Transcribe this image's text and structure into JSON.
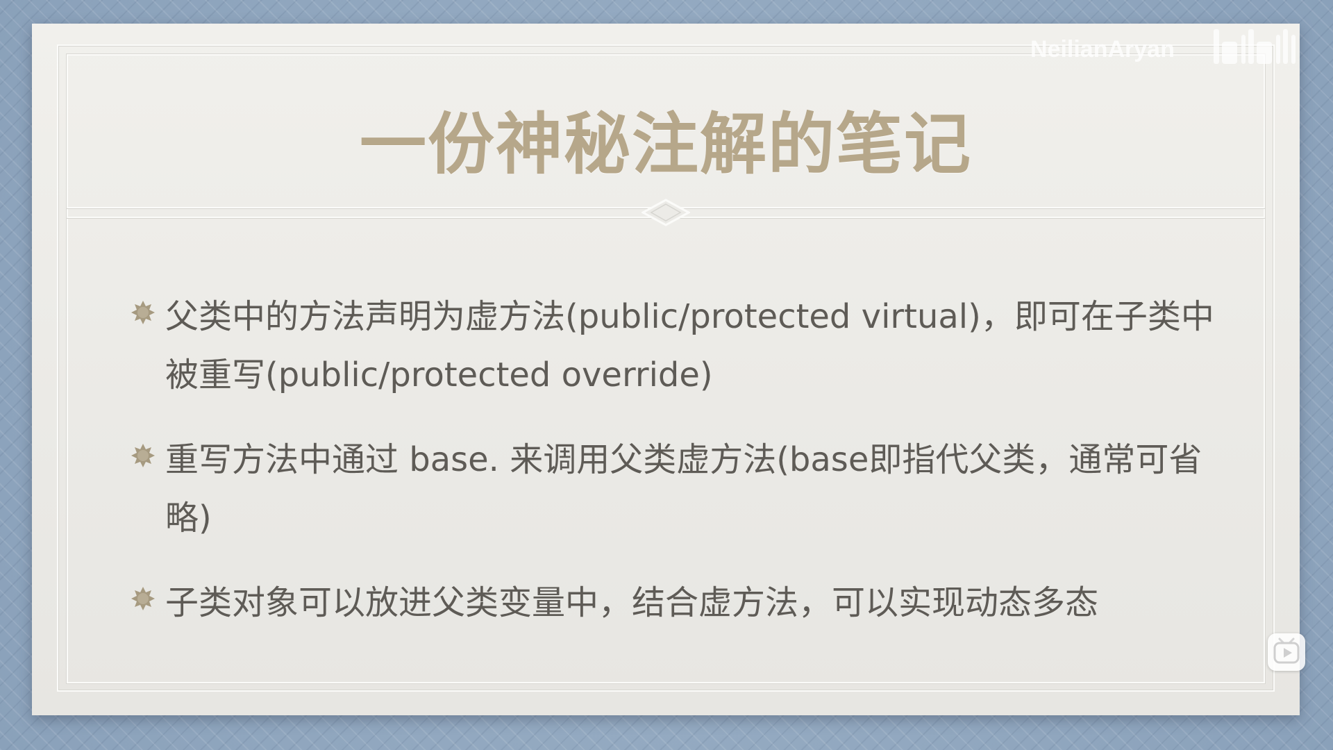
{
  "slide": {
    "title": "一份神秘注解的笔记",
    "bullets": [
      "父类中的方法声明为虚方法(public/protected virtual)，即可在子类中被重写(public/protected override)",
      "重写方法中通过 base. 来调用父类虚方法(base即指代父类，通常可省略)",
      "子类对象可以放进父类变量中，结合虚方法，可以实现动态多态"
    ]
  },
  "overlay": {
    "watermark": "NeilianAryan",
    "logo_text": "bilibili",
    "logo_icon": "bilibili-logo-icon",
    "player_icon": "play-icon"
  },
  "colors": {
    "background": "#8fa6be",
    "card": "#efeeea",
    "title": "#b6a78a",
    "body_text": "#5e5b56",
    "bullet": "#a69a80"
  }
}
